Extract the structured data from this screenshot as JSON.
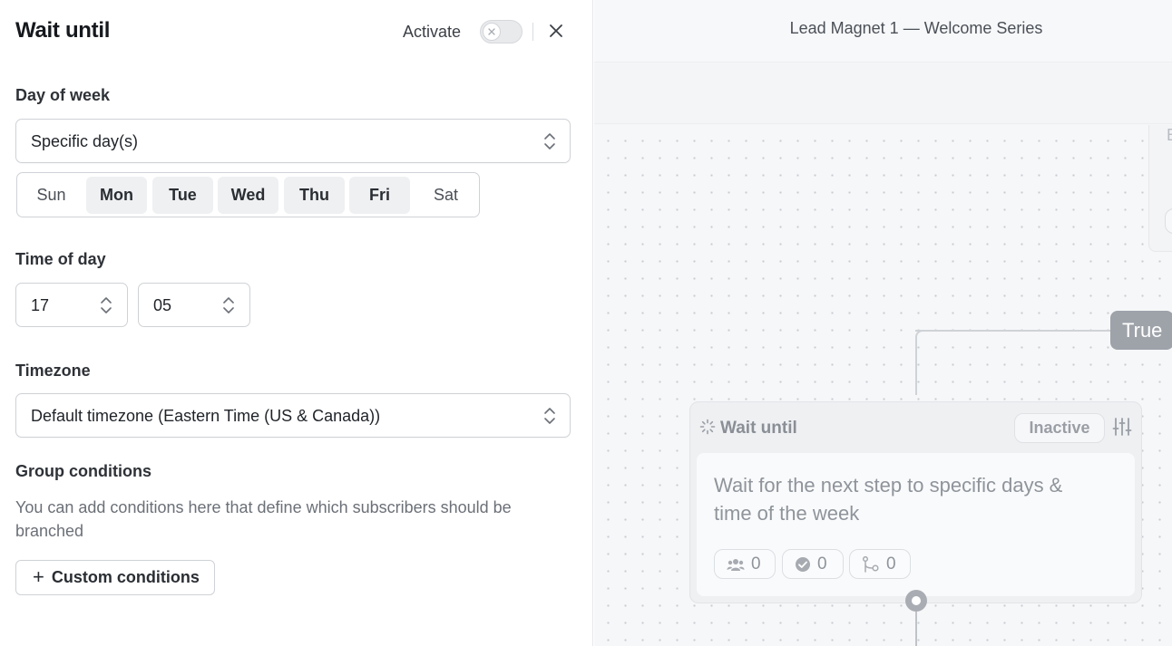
{
  "panel": {
    "title": "Wait until",
    "activate_label": "Activate",
    "activate_enabled": false,
    "day_of_week": {
      "label": "Day of week",
      "mode": "Specific day(s)",
      "days": [
        {
          "label": "Sun",
          "selected": false
        },
        {
          "label": "Mon",
          "selected": true
        },
        {
          "label": "Tue",
          "selected": true
        },
        {
          "label": "Wed",
          "selected": true
        },
        {
          "label": "Thu",
          "selected": true
        },
        {
          "label": "Fri",
          "selected": true
        },
        {
          "label": "Sat",
          "selected": false
        }
      ]
    },
    "time_of_day": {
      "label": "Time of day",
      "hour": "17",
      "minute": "05"
    },
    "timezone": {
      "label": "Timezone",
      "value": "Default timezone (Eastern Time (US & Canada))"
    },
    "group_conditions": {
      "label": "Group conditions",
      "helper": "You can add conditions here that define which subscribers should be branched",
      "button_label": "Custom conditions"
    }
  },
  "canvas": {
    "workflow_title": "Lead Magnet 1 — Welcome Series",
    "branch_label": "True",
    "node": {
      "title": "Wait until",
      "status": "Inactive",
      "description": "Wait for the next step to specific days & time of the week",
      "stats": [
        {
          "icon": "users-icon",
          "value": "0"
        },
        {
          "icon": "check-circle-icon",
          "value": "0"
        },
        {
          "icon": "branch-icon",
          "value": "0"
        }
      ]
    }
  },
  "colors": {
    "accent_toggle_off": "#e9eaec",
    "true_pill": "#9ea2a9",
    "canvas_bg": "#f6f7f8"
  }
}
